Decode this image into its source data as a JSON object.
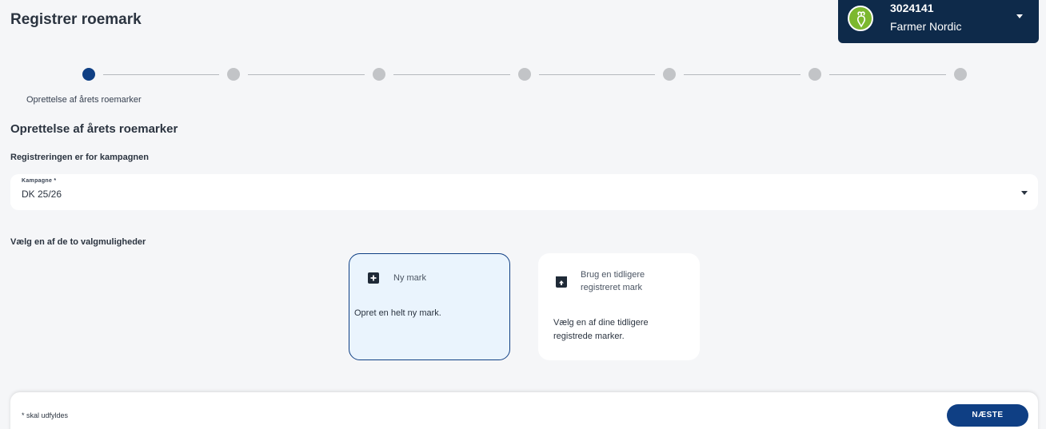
{
  "header": {
    "title": "Registrer roemark",
    "account": {
      "id": "3024141",
      "name": "Farmer Nordic",
      "logo_icon": "sugar-beet-icon",
      "logo_color": "#7cb82f",
      "box_color": "#0e2a4a"
    }
  },
  "stepper": {
    "active_index": 0,
    "total_steps": 7,
    "active_label": "Oprettelse af årets roemarker",
    "active_color": "#0f3f84",
    "inactive_color": "#c2c4c7"
  },
  "main": {
    "section_title": "Oprettelse af årets roemarker",
    "subsection_title": "Registreringen er for kampagnen",
    "campaign": {
      "label": "Kampagne *",
      "value": "DK 25/26"
    },
    "choose_label": "Vælg en af de to valgmuligheder",
    "options": [
      {
        "title": "Ny mark",
        "description": "Opret en helt ny mark.",
        "icon": "plus-square-icon",
        "selected": true
      },
      {
        "title": "Brug en tidligere registreret mark",
        "description": "Vælg en af dine tidligere registrede marker.",
        "icon": "archive-icon",
        "selected": false
      }
    ]
  },
  "footer": {
    "required_note": "* skal udfyldes",
    "next_label": "NÆSTE"
  }
}
